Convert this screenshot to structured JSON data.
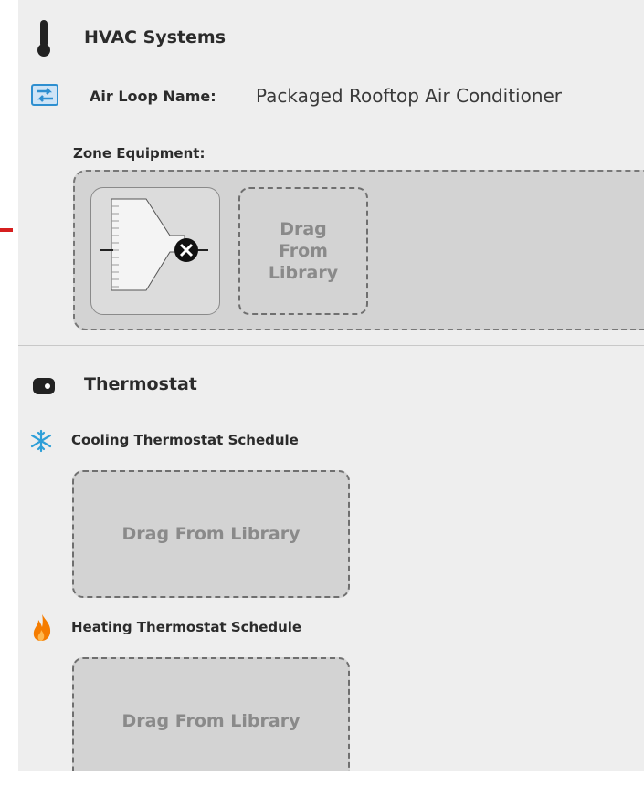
{
  "hvac": {
    "title": "HVAC Systems",
    "air_loop_label": "Air Loop Name:",
    "air_loop_value": "Packaged Rooftop Air Conditioner",
    "zone_equipment_label": "Zone Equipment:",
    "drop_tile_label": "Drag\nFrom\nLibrary",
    "equipment_icon": "diffuser-terminal-icon"
  },
  "thermostat": {
    "title": "Thermostat",
    "cooling_label": "Cooling Thermostat Schedule",
    "cooling_drop_label": "Drag From Library",
    "heating_label": "Heating Thermostat Schedule",
    "heating_drop_label": "Drag From Library"
  },
  "colors": {
    "panel_bg": "#eeeeee",
    "callout_arrow": "#d61f1f",
    "cooling_icon": "#2e9fd8",
    "heating_icon": "#f57c00",
    "loop_icon": "#2e8fd0"
  }
}
